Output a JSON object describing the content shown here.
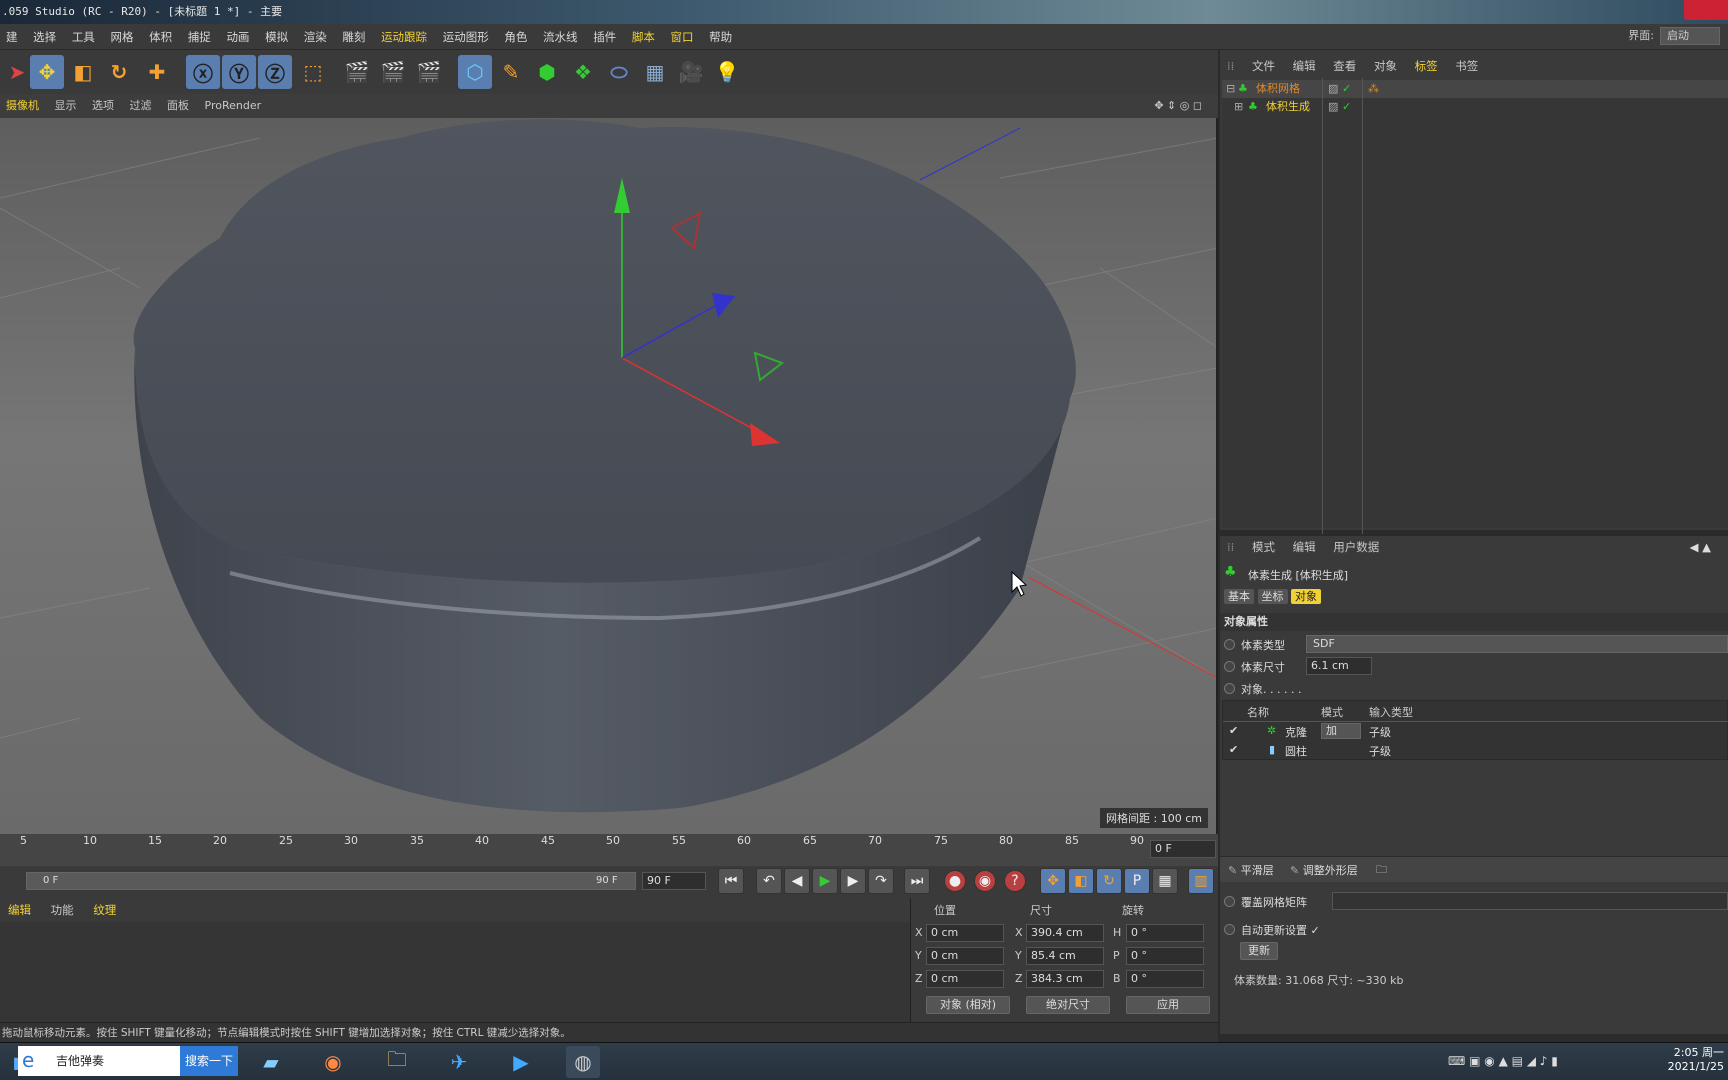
{
  "window": {
    "title": ".059 Studio (RC - R20) - [未标题 1 *] - 主要"
  },
  "menu": {
    "items": [
      "建",
      "选择",
      "工具",
      "网格",
      "体积",
      "捕捉",
      "动画",
      "模拟",
      "渲染",
      "雕刻",
      "运动跟踪",
      "运动图形",
      "角色",
      "流水线",
      "插件",
      "脚本",
      "窗口",
      "帮助"
    ],
    "interface_label": "界面:",
    "interface_value": "启动"
  },
  "viewport": {
    "tabs": [
      "摄像机",
      "显示",
      "选项",
      "过滤",
      "面板",
      "ProRender"
    ],
    "grid_info": "网格间距 : 100 cm"
  },
  "timeline": {
    "ticks": [
      "5",
      "10",
      "15",
      "20",
      "25",
      "30",
      "35",
      "40",
      "45",
      "50",
      "55",
      "60",
      "65",
      "70",
      "75",
      "80",
      "85",
      "90"
    ],
    "current_frame": "0 F",
    "scrub_start": "0 F",
    "scrub_end": "90 F",
    "end_frame": "90 F"
  },
  "bottom_tabs": [
    "编辑",
    "功能",
    "纹理"
  ],
  "coords": {
    "headers": [
      "位置",
      "尺寸",
      "旋转"
    ],
    "rows": [
      {
        "axis": "X",
        "pos": "0 cm",
        "size_axis": "X",
        "size": "390.4 cm",
        "rot_axis": "H",
        "rot": "0 °"
      },
      {
        "axis": "Y",
        "pos": "0 cm",
        "size_axis": "Y",
        "size": "85.4 cm",
        "rot_axis": "P",
        "rot": "0 °"
      },
      {
        "axis": "Z",
        "pos": "0 cm",
        "size_axis": "Z",
        "size": "384.3 cm",
        "rot_axis": "B",
        "rot": "0 °"
      }
    ],
    "mode": "对象 (相对)",
    "size_mode": "绝对尺寸",
    "apply": "应用"
  },
  "status": "拖动鼠标移动元素。按住 SHIFT 键量化移动；节点编辑模式时按住 SHIFT 键增加选择对象；按住 CTRL 键减少选择对象。",
  "object_manager": {
    "tabs": [
      "文件",
      "编辑",
      "查看",
      "对象",
      "标签",
      "书签"
    ],
    "objects": [
      {
        "name": "体积网格"
      },
      {
        "name": "体积生成"
      }
    ]
  },
  "attributes": {
    "tabs": [
      "模式",
      "编辑",
      "用户数据"
    ],
    "object_title": "体素生成 [体积生成]",
    "subtabs": [
      "基本",
      "坐标",
      "对象"
    ],
    "section": "对象属性",
    "voxel_type_label": "体素类型",
    "voxel_type": "SDF",
    "voxel_size_label": "体素尺寸",
    "voxel_size": "6.1 cm",
    "objects_label": "对象. . . . . .",
    "table_headers": [
      "名称",
      "模式",
      "输入类型"
    ],
    "table_rows": [
      {
        "name": "克隆",
        "mode": "加",
        "input": "子级"
      },
      {
        "name": "圆柱",
        "mode": "",
        "input": "子级"
      }
    ],
    "layer_buttons": [
      "平滑层",
      "调整外形层"
    ],
    "override_label": "覆盖网格矩阵",
    "auto_update_label": "自动更新设置",
    "auto_update_check": "✓",
    "update_button": "更新",
    "info": "体素数量: 31.068   尺寸: ~330 kb"
  },
  "taskbar": {
    "search_text": "吉他弹奏",
    "search_button": "搜索一下",
    "clock_time": "2:05 周一",
    "clock_date": "2021/1/25"
  },
  "colors": {
    "accent": "#f2d233",
    "selection": "#5b7eb0",
    "axis_x": "#d33",
    "axis_y": "#3c3",
    "axis_z": "#33c"
  }
}
